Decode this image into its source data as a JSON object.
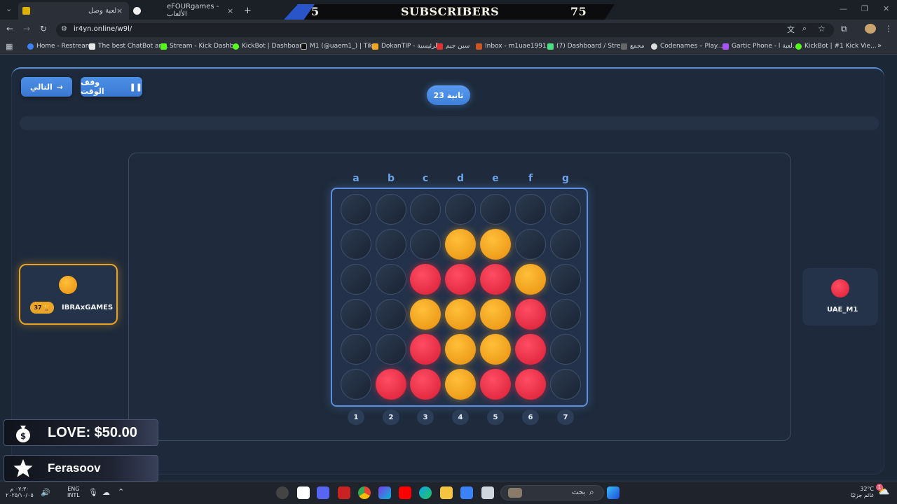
{
  "browser": {
    "tabs": [
      {
        "label": "لعبة وصل"
      },
      {
        "label": "eFOURgames - الألعاب"
      }
    ],
    "new_tab": "+",
    "url": "ir4yn.online/w9l/",
    "bookmarks": [
      "Home - Restream",
      "The best ChatBot an...",
      "Stream - Kick Dashb...",
      "KickBot | Dashboard",
      "M1 (@uaem1_) | Tik...",
      "DokanTIP - الرئيسية",
      "سين جيم",
      "Inbox - m1uae1991...",
      "(7) Dashboard / Stre...",
      "مجمع",
      "Codenames – Play...",
      "Gartic Phone - لعبة ا...",
      "KickBot | #1 Kick Vie..."
    ]
  },
  "subscriber_banner": {
    "left_count": "5",
    "label": "SUBSCRIBERS",
    "right_count": "75"
  },
  "controls": {
    "next_label": "التالي",
    "pause_label": "وقف الوقت",
    "timer": "23 ثانية"
  },
  "board": {
    "columns": [
      "a",
      "b",
      "c",
      "d",
      "e",
      "f",
      "g"
    ],
    "column_numbers": [
      "1",
      "2",
      "3",
      "4",
      "5",
      "6",
      "7"
    ],
    "grid": [
      [
        "empty",
        "empty",
        "empty",
        "empty",
        "empty",
        "empty",
        "empty"
      ],
      [
        "empty",
        "empty",
        "empty",
        "yellow",
        "yellow",
        "empty",
        "empty"
      ],
      [
        "empty",
        "empty",
        "red",
        "red",
        "red",
        "yellow",
        "empty"
      ],
      [
        "empty",
        "empty",
        "yellow",
        "yellow",
        "yellow",
        "red",
        "empty"
      ],
      [
        "empty",
        "empty",
        "red",
        "yellow",
        "yellow",
        "red",
        "empty"
      ],
      [
        "empty",
        "red",
        "red",
        "yellow",
        "red",
        "red",
        "empty"
      ]
    ],
    "colors": {
      "yellow": "#f5a623",
      "red": "#f0304a",
      "board_border": "#5a8fe0"
    }
  },
  "players": {
    "left": {
      "name": "IBRAxGAMES",
      "score": "37",
      "piece": "yellow"
    },
    "right": {
      "name": "UAE_M1",
      "piece": "red"
    }
  },
  "stream_overlays": [
    {
      "text": "LOVE: $50.00",
      "icon": "money-bag-icon"
    },
    {
      "text": "Ferasoov",
      "icon": "star-icon"
    }
  ],
  "taskbar": {
    "search_placeholder": "بحث",
    "lang_line1": "ENG",
    "lang_line2": "INTL",
    "time": "٠٧:٣٠ م",
    "date": "٢٠٢٥/١٠/٠٥",
    "weather_temp": "32°C",
    "weather_desc": "غائم جزئيًا",
    "notification_count": "1"
  }
}
